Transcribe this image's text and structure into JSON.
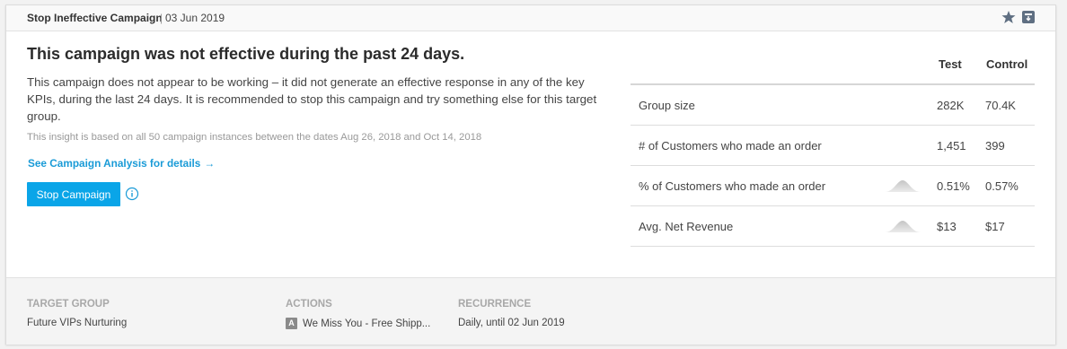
{
  "header": {
    "title": "Stop Ineffective Campaign",
    "separator": "|",
    "date": "03 Jun 2019",
    "star_icon": "star-icon",
    "archive_icon": "archive-icon",
    "icon_color": "#5f6f82"
  },
  "main": {
    "headline": "This campaign was not effective during the past 24 days.",
    "description": "This campaign does not appear to be working – it did not generate an effective response in any of the key KPIs, during the last 24 days. It is recommended to stop this campaign and try something else for this target group.",
    "insight_note": "This insight is based on all 50 campaign instances between the dates Aug 26, 2018 and Oct 14, 2018",
    "link_label": "See Campaign Analysis for details",
    "link_arrow": "→",
    "stop_button_label": "Stop Campaign",
    "info_icon": "info-icon",
    "accent_color": "#0aa5e8"
  },
  "table": {
    "columns": [
      "Test",
      "Control"
    ],
    "rows": [
      {
        "label": "Group size",
        "test": "282K",
        "control": "70.4K",
        "sparkline": false
      },
      {
        "label": "# of Customers who made an order",
        "test": "1,451",
        "control": "399",
        "sparkline": false
      },
      {
        "label": "% of Customers who made an order",
        "test": "0.51%",
        "control": "0.57%",
        "sparkline": true
      },
      {
        "label": "Avg. Net Revenue",
        "test": "$13",
        "control": "$17",
        "sparkline": true
      }
    ]
  },
  "footer": {
    "target_group": {
      "heading": "TARGET GROUP",
      "value": "Future VIPs Nurturing"
    },
    "actions": {
      "heading": "ACTIONS",
      "badge": "A",
      "value": "We Miss You - Free Shipp..."
    },
    "recurrence": {
      "heading": "RECURRENCE",
      "value": "Daily, until 02 Jun 2019"
    }
  }
}
